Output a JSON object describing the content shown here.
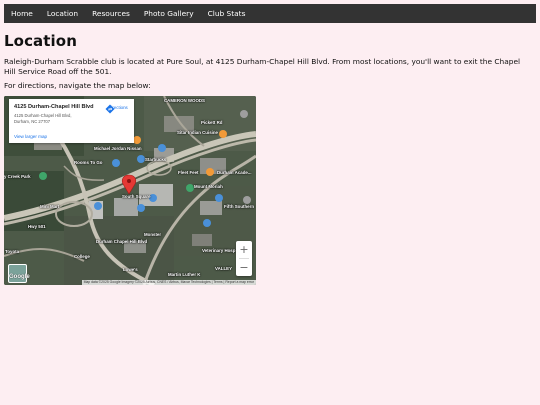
{
  "nav": {
    "items": [
      {
        "label": "Home"
      },
      {
        "label": "Location"
      },
      {
        "label": "Resources"
      },
      {
        "label": "Photo Gallery"
      },
      {
        "label": "Club Stats"
      }
    ]
  },
  "page": {
    "title": "Location",
    "intro": "Raleigh-Durham Scrabble club is located at Pure Soul, at 4125 Durham-Chapel Hill Blvd. From most locations, you'll want to exit the Chapel Hill Service Road off the 501.",
    "directions_text": "For directions, navigate the map below:"
  },
  "map": {
    "card": {
      "title": "4125 Durham-Chapel Hill Blvd",
      "address_line1": "4125 Durham-Chapel Hill Blvd,",
      "address_line2": "Durham, NC 27707",
      "directions_label": "Directions",
      "larger_map_label": "View larger map"
    },
    "labels": {
      "cameron_woods": "CAMERON WOODS",
      "pickett_rd": "Pickett Rd",
      "sitar": "Sitar Indian Cuisine",
      "michael_jordan": "Michael Jordan Nissan",
      "starbucks": "Starbucks",
      "rooms_to_go": "Rooms To Go",
      "durham_academy": "Durham Acade...",
      "creek_park": "y Creek Park",
      "fleet": "Fleet Feet",
      "mount_moriah": "Mount Moriah",
      "south_square": "South Square",
      "monster": "Monster",
      "mini_market": "Mini Mart",
      "veterinary": "Veterinary Hosp",
      "lowes": "Lowe's",
      "college": "College",
      "dabney": "Durham Chapel Hill Blvd",
      "martin_luther": "Martin Luther K",
      "hwy": "Hwy 501",
      "toyota": "Toyota",
      "valley": "VALLEY",
      "fifth": "Fifth Southern"
    },
    "zoom_in": "+",
    "zoom_out": "−",
    "logo": "Google",
    "attribution": "Map data ©2025 Google Imagery ©2025 Airbus, CNES / Airbus, Maxar Technologies | Terms | Report a map error",
    "colors": {
      "pin": "#e53935",
      "poi_blue": "#4a90d9",
      "poi_orange": "#f29a38",
      "poi_green": "#3fa66a"
    }
  }
}
